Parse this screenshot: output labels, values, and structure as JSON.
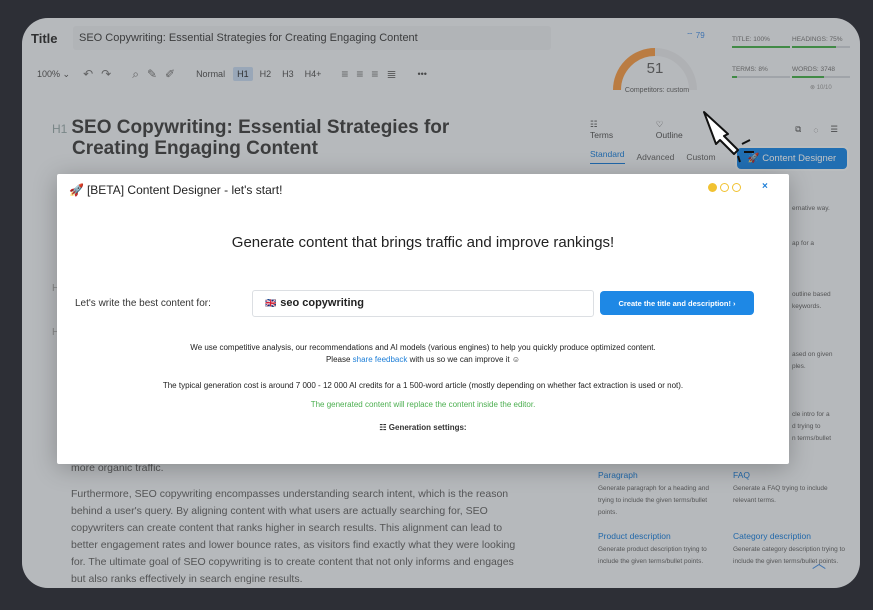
{
  "editor": {
    "title_label": "Title",
    "title_value": "SEO Copywriting: Essential Strategies for Creating Engaging Content",
    "toolbar": {
      "zoom": "100%",
      "style_normal": "Normal",
      "headings": [
        "H1",
        "H2",
        "H3",
        "H4+"
      ],
      "active_heading": "H1",
      "more": "•••"
    },
    "h1_tag": "H1",
    "h1_line1": "SEO Copywriting: Essential Strategies for",
    "h1_line2": "Creating Engaging Content",
    "h_marker": "H",
    "body_paragraphs": [
      "more organic traffic.",
      "Furthermore, SEO copywriting encompasses understanding search intent, which is the reason behind a user's query. By aligning content with what users are actually searching for, SEO copywriters can create content that ranks higher in search results. This alignment can lead to better engagement rates and lower bounce rates, as visitors find exactly what they were looking for. The ultimate goal of SEO copywriting is to create content that not only informs and engages but also ranks effectively in search engine results."
    ]
  },
  "score": {
    "value": "51",
    "competitors": "Competitors: custom",
    "wifi_count": "79",
    "stats": [
      {
        "label": "TITLE: 100%",
        "fill": 1.0
      },
      {
        "label": "HEADINGS: 75%",
        "fill": 0.75
      },
      {
        "label": "TERMS: 8%",
        "fill": 0.08
      },
      {
        "label": "WORDS: 3748",
        "fill": 0.55
      }
    ],
    "grade": "⊗ 10/10"
  },
  "panel": {
    "tabs": [
      "Terms",
      "Outline"
    ],
    "sub_tabs": [
      "Standard",
      "Advanced",
      "Custom"
    ],
    "active_sub_tab": "Standard",
    "content_designer_button": "Content Designer",
    "fragments": [
      "ernative way.",
      "ap for a",
      "outline based",
      "keywords.",
      "ased on given",
      "ples.",
      "cle intro for a",
      "d trying to",
      "n terms/bullet"
    ],
    "cards": [
      {
        "title": "Paragraph",
        "desc": "Generate paragraph for a heading and trying to include the given terms/bullet points."
      },
      {
        "title": "FAQ",
        "desc": "Generate a FAQ trying to include relevant terms."
      },
      {
        "title": "Product description",
        "desc": "Generate product description trying to include the given terms/bullet points."
      },
      {
        "title": "Category description",
        "desc": "Generate category description trying to include the given terms/bullet points."
      }
    ]
  },
  "modal": {
    "title": "[BETA] Content Designer - let's start!",
    "close": "×",
    "headline": "Generate content that brings traffic and improve rankings!",
    "lets_write_label": "Let's write the best content for:",
    "keyword": "seo copywriting",
    "flag": "🇬🇧",
    "create_button": "Create the title and description! ›",
    "info_line1": "We use competitive analysis, our recommendations and AI models (various engines) to help you quickly produce optimized content.",
    "info_line2_pre": "Please ",
    "info_line2_link": "share feedback",
    "info_line2_post": " with us so we can improve it ☺",
    "cost_line": "The typical generation cost is around 7 000 - 12 000 AI credits for a 1 500-word article (mostly depending on whether fact extraction is used or not).",
    "replace_notice": "The generated content will replace the content inside the editor.",
    "generation_settings": "☷ Generation settings:"
  },
  "colors": {
    "accent": "#1e88e5",
    "green": "#4caf50",
    "gauge_orange": "#f39c4a",
    "dot_yellow": "#f1c232"
  }
}
